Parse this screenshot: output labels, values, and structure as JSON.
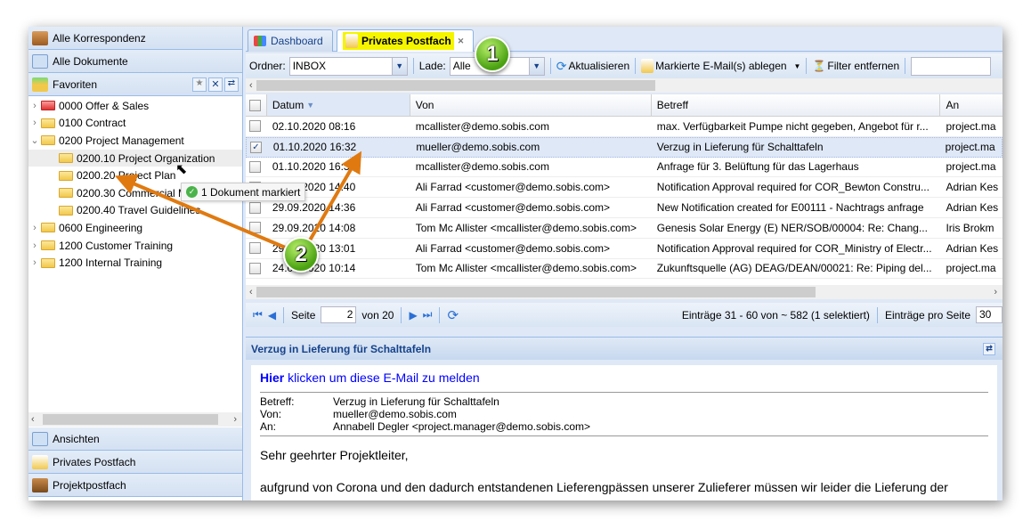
{
  "left": {
    "accordion_top": [
      {
        "label": "Alle Korrespondenz",
        "icon": "briefcase-icon"
      },
      {
        "label": "Alle Dokumente",
        "icon": "documents-icon"
      },
      {
        "label": "Favoriten",
        "icon": "favorites-icon"
      }
    ],
    "tree": [
      {
        "label": "0000 Offer & Sales",
        "level": 0,
        "expanded": false,
        "color": "red"
      },
      {
        "label": "0100 Contract",
        "level": 0,
        "expanded": false
      },
      {
        "label": "0200 Project Management",
        "level": 0,
        "expanded": true
      },
      {
        "label": "0200.10 Project Organization",
        "level": 1,
        "hover": true
      },
      {
        "label": "0200.20 Project Plan",
        "level": 1
      },
      {
        "label": "0200.30 Commercial Management",
        "level": 1
      },
      {
        "label": "0200.40 Travel Guidelines",
        "level": 1
      },
      {
        "label": "0600 Engineering",
        "level": 0,
        "expanded": false
      },
      {
        "label": "1200 Customer Training",
        "level": 0,
        "expanded": false
      },
      {
        "label": "1200 Internal Training",
        "level": 0,
        "expanded": false
      }
    ],
    "accordion_bottom": [
      {
        "label": "Ansichten",
        "icon": "views-icon"
      },
      {
        "label": "Privates Postfach",
        "icon": "mailbox-icon"
      },
      {
        "label": "Projektpostfach",
        "icon": "project-mailbox-icon"
      }
    ]
  },
  "tabs": [
    {
      "label": "Dashboard",
      "active": false
    },
    {
      "label": "Privates Postfach",
      "active": true,
      "highlight": "#f5f500"
    }
  ],
  "toolbar": {
    "folder_label": "Ordner:",
    "folder_value": "INBOX",
    "load_label": "Lade:",
    "load_value": "Alle",
    "refresh": "Aktualisieren",
    "file_marked": "Markierte E-Mail(s) ablegen",
    "remove_filter": "Filter entfernen",
    "search_value": ""
  },
  "grid": {
    "columns": [
      "Datum",
      "Von",
      "Betreff",
      "An"
    ],
    "sort": "Datum descending",
    "rows": [
      {
        "checked": false,
        "date": "02.10.2020 08:16",
        "from": "mcallister@demo.sobis.com",
        "subject": "max. Verfügbarkeit Pumpe nicht gegeben, Angebot für r...",
        "to": "project.ma"
      },
      {
        "checked": true,
        "date": "01.10.2020 16:32",
        "from": "mueller@demo.sobis.com",
        "subject": "Verzug in Lieferung für Schalttafeln",
        "to": "project.ma"
      },
      {
        "checked": false,
        "date": "01.10.2020 16:31",
        "from": "mcallister@demo.sobis.com",
        "subject": "Anfrage für 3. Belüftung für das Lagerhaus",
        "to": "project.ma"
      },
      {
        "checked": false,
        "date": "29.09.2020 14:40",
        "from": "Ali Farrad <customer@demo.sobis.com>",
        "subject": "Notification Approval required for COR_Bewton Constru...",
        "to": "Adrian Kes"
      },
      {
        "checked": false,
        "date": "29.09.2020 14:36",
        "from": "Ali Farrad <customer@demo.sobis.com>",
        "subject": "New Notification created for E00111 - Nachtrags anfrage",
        "to": "Adrian Kes"
      },
      {
        "checked": false,
        "date": "29.09.2020 14:08",
        "from": "Tom Mc Allister <mcallister@demo.sobis.com>",
        "subject": "Genesis Solar Energy (E) NER/SOB/00004: Re: Chang...",
        "to": "Iris Brokm"
      },
      {
        "checked": false,
        "date": "29.09.2020 13:01",
        "from": "Ali Farrad <customer@demo.sobis.com>",
        "subject": "Notification Approval required for COR_Ministry of Electr...",
        "to": "Adrian Kes"
      },
      {
        "checked": false,
        "date": "24.09.2020 10:14",
        "from": "Tom Mc Allister <mcallister@demo.sobis.com>",
        "subject": "Zukunftsquelle (AG) DEAG/DEAN/00021: Re: Piping del...",
        "to": "project.ma"
      }
    ]
  },
  "pager": {
    "page_label": "Seite",
    "page": "2",
    "of": "von 20",
    "info": "Einträge 31 - 60 von ~ 582  (1 selektiert)",
    "per_page_label": "Einträge pro Seite",
    "per_page": "30"
  },
  "preview": {
    "title": "Verzug in Lieferung für Schalttafeln",
    "report_bold": "Hier",
    "report_rest": " klicken um diese E-Mail zu melden",
    "meta": [
      {
        "k": "Betreff:",
        "v": "Verzug in Lieferung für Schalttafeln"
      },
      {
        "k": "Von:",
        "v": "mueller@demo.sobis.com"
      },
      {
        "k": "An:",
        "v": "Annabell Degler <project.manager@demo.sobis.com>"
      }
    ],
    "greeting": "Sehr geehrter Projektleiter,",
    "body": "aufgrund von Corona und den dadurch entstandenen Lieferengpässen unserer Zulieferer müssen wir leider die Lieferung der"
  },
  "annotations": {
    "badge1": "1",
    "badge2": "2",
    "tooltip": "1 Dokument markiert",
    "arrow_color": "#e07a10"
  }
}
